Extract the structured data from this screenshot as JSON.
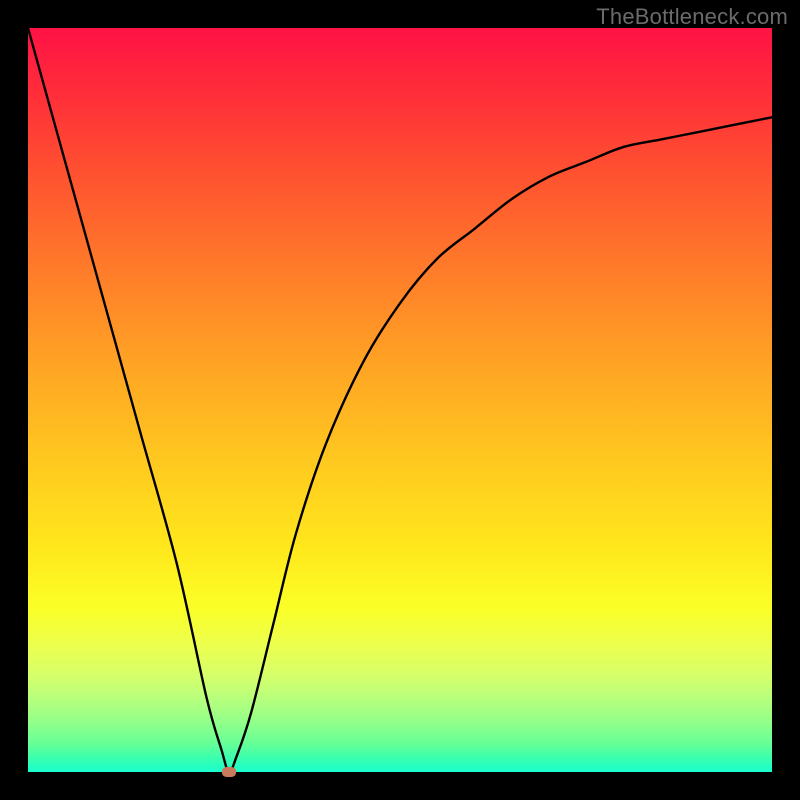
{
  "watermark": "TheBottleneck.com",
  "chart_data": {
    "type": "line",
    "title": "",
    "xlabel": "",
    "ylabel": "",
    "xlim": [
      0,
      100
    ],
    "ylim": [
      0,
      100
    ],
    "grid": false,
    "series": [
      {
        "name": "bottleneck-curve",
        "x": [
          0,
          5,
          10,
          15,
          20,
          24,
          26,
          27,
          28,
          30,
          33,
          36,
          40,
          45,
          50,
          55,
          60,
          65,
          70,
          75,
          80,
          85,
          90,
          95,
          100
        ],
        "y": [
          100,
          82,
          64,
          46,
          28,
          10,
          3,
          0,
          2,
          8,
          20,
          32,
          44,
          55,
          63,
          69,
          73,
          77,
          80,
          82,
          84,
          85,
          86,
          87,
          88
        ]
      }
    ],
    "marker": {
      "x": 27,
      "y": 0,
      "color": "#c97a5d"
    },
    "gradient_stops": [
      {
        "pct": 0,
        "color": "#ff1245"
      },
      {
        "pct": 8,
        "color": "#ff2b3a"
      },
      {
        "pct": 20,
        "color": "#ff5330"
      },
      {
        "pct": 32,
        "color": "#ff7a2a"
      },
      {
        "pct": 45,
        "color": "#ffa324"
      },
      {
        "pct": 58,
        "color": "#ffc81f"
      },
      {
        "pct": 70,
        "color": "#ffe81c"
      },
      {
        "pct": 78,
        "color": "#fbff27"
      },
      {
        "pct": 83,
        "color": "#ecff4e"
      },
      {
        "pct": 87,
        "color": "#d6ff6a"
      },
      {
        "pct": 90,
        "color": "#b9ff7c"
      },
      {
        "pct": 93,
        "color": "#96ff88"
      },
      {
        "pct": 96,
        "color": "#6aff95"
      },
      {
        "pct": 98,
        "color": "#3cffac"
      },
      {
        "pct": 100,
        "color": "#18ffce"
      }
    ]
  },
  "layout": {
    "image_size": 800,
    "plot_inset": 28,
    "plot_size": 744
  }
}
